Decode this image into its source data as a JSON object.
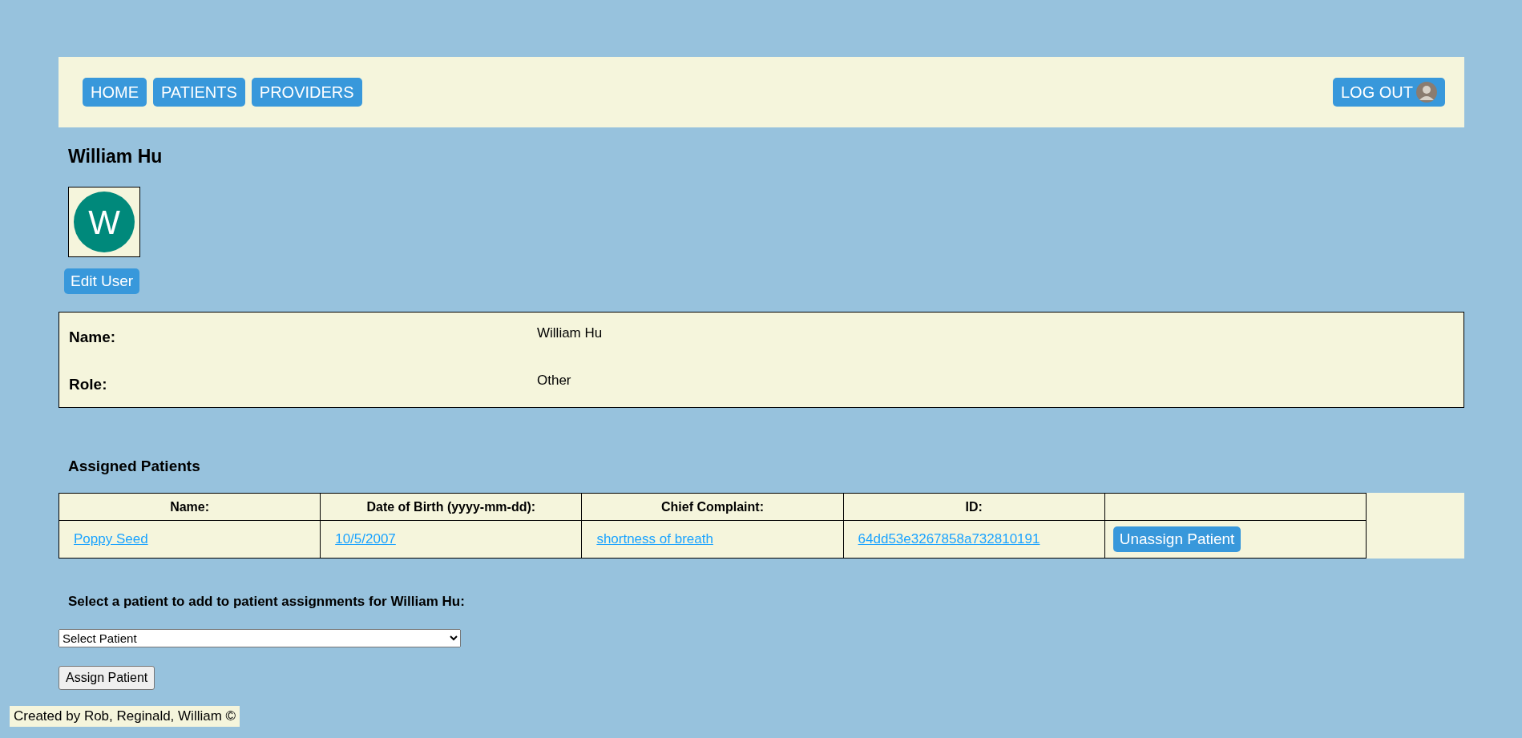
{
  "nav": {
    "links": [
      {
        "label": "HOME"
      },
      {
        "label": "PATIENTS"
      },
      {
        "label": "PROVIDERS"
      }
    ],
    "logout": "LOG OUT"
  },
  "profile": {
    "name": "William Hu",
    "initial": "W",
    "edit_button": "Edit User"
  },
  "details": [
    {
      "label": "Name:",
      "value": "William Hu"
    },
    {
      "label": "Role:",
      "value": "Other"
    }
  ],
  "assigned": {
    "title": "Assigned Patients",
    "columns": [
      "Name:",
      "Date of Birth (yyyy-mm-dd):",
      "Chief Complaint:",
      "ID:"
    ],
    "rows": [
      {
        "name": "Poppy Seed",
        "dob": "10/5/2007",
        "complaint": "shortness of breath",
        "id": "64dd53e3267858a732810191",
        "action": "Unassign Patient"
      }
    ]
  },
  "assign": {
    "label": "Select a patient to add to patient assignments for William Hu:",
    "select_value": "Select Patient",
    "button": "Assign Patient"
  },
  "footer": "Created by Rob, Reginald, William ©"
}
